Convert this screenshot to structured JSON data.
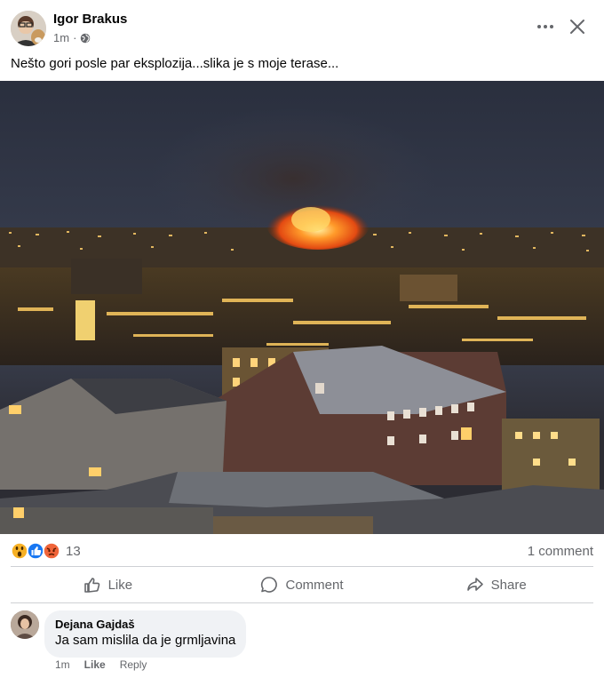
{
  "post": {
    "author": "Igor Brakus",
    "time": "1m",
    "separator": "·",
    "privacy_icon": "globe-icon",
    "text": "Nešto gori posle par eksplozija...slika je s moje terase..."
  },
  "reactions": {
    "icons": [
      "wow-reaction-icon",
      "like-reaction-icon",
      "angry-reaction-icon"
    ],
    "count": "13",
    "comments": "1 comment"
  },
  "actions": {
    "like": "Like",
    "comment": "Comment",
    "share": "Share"
  },
  "comment": {
    "author": "Dejana Gajdaš",
    "text": "Ja sam mislila da je grmljavina",
    "time": "1m",
    "like": "Like",
    "reply": "Reply"
  },
  "colors": {
    "secondary_text": "#65676b",
    "divider": "#ced0d4",
    "bubble": "#f0f2f5",
    "like_blue": "#1877f2",
    "angry_orange": "#f0653a",
    "wow_yellow": "#f7b125"
  }
}
